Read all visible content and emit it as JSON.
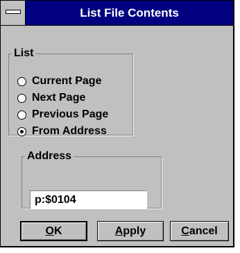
{
  "window": {
    "title": "List File Contents"
  },
  "list_group": {
    "label": "List",
    "options": [
      {
        "label": "Current Page",
        "checked": false
      },
      {
        "label": "Next Page",
        "checked": false
      },
      {
        "label": "Previous Page",
        "checked": false
      },
      {
        "label": "From Address",
        "checked": true
      }
    ]
  },
  "address_group": {
    "label": "Address",
    "value": "p:$0104"
  },
  "buttons": {
    "ok": {
      "mnemonic": "O",
      "rest": "K"
    },
    "apply": {
      "mnemonic": "A",
      "rest": "pply"
    },
    "cancel": {
      "mnemonic": "C",
      "rest": "ancel"
    }
  },
  "colors": {
    "titlebar": "#000080",
    "face": "#c0c0c0"
  },
  "icons": {
    "system_menu": "system-menu-icon"
  }
}
